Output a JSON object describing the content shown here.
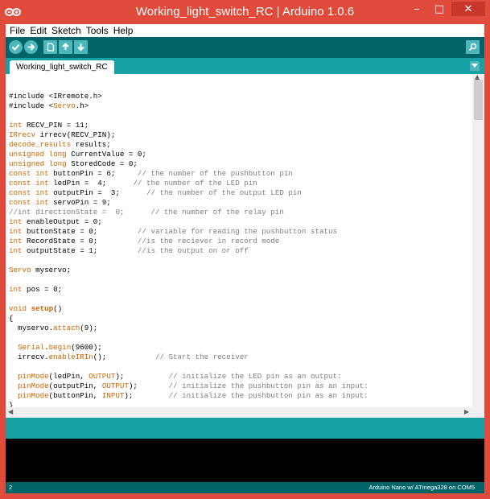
{
  "window": {
    "title": "Working_light_switch_RC | Arduino 1.0.6",
    "min_glyph": "–",
    "max_glyph": "□",
    "close_glyph": "✕"
  },
  "menu": [
    "File",
    "Edit",
    "Sketch",
    "Tools",
    "Help"
  ],
  "toolbar": {
    "verify_icon": "checkmark-icon",
    "upload_icon": "right-arrow-icon",
    "new_icon": "new-file-icon",
    "open_icon": "up-arrow-icon",
    "save_icon": "down-arrow-icon",
    "serial_icon": "magnifier-icon"
  },
  "tab": {
    "label": "Working_light_switch_RC"
  },
  "code": [
    "",
    "#include <IRremote.h>",
    "#include <Servo.h>",
    "",
    "int RECV_PIN = 11;",
    "IRrecv irrecv(RECV_PIN);",
    "decode_results results;",
    "unsigned long CurrentValue = 0;",
    "unsigned long StoredCode = 0;",
    "const int buttonPin = 6;     // the number of the pushbutton pin",
    "const int ledPin =  4;      // the number of the LED pin",
    "const int outputPin =  3;      // the number of the output LED pin",
    "const int servoPin = 9;",
    "//int directionState =  0;      // the number of the relay pin",
    "int enableOutput = 0;",
    "int buttonState = 0;         // variable for reading the pushbutton status",
    "int RecordState = 0;         //is the reciever in record mode",
    "int outputState = 1;         //is the output on or off",
    "",
    "Servo myservo;",
    "",
    "int pos = 0;",
    "",
    "void setup()",
    "{",
    "  myservo.attach(9);",
    "",
    "  Serial.begin(9600);",
    "  irrecv.enableIRIn();           // Start the receiver",
    "",
    "  pinMode(ledPin, OUTPUT);          // initialize the LED pin as an output:",
    "  pinMode(outputPin, OUTPUT);       // initialize the pushbutton pin as an input:",
    "  pinMode(buttonPin, INPUT);        // initialize the pushbutton pin as an input:",
    "}"
  ],
  "status": {
    "line_number": "2",
    "board": "Arduino Nano w/ ATmega328 on COM5"
  },
  "colors": {
    "title_bar": "#e14b3b",
    "toolbar": "#006468",
    "tab_strip": "#17a1a5",
    "keyword": "#cc6600",
    "comment": "#7e7e7e"
  }
}
